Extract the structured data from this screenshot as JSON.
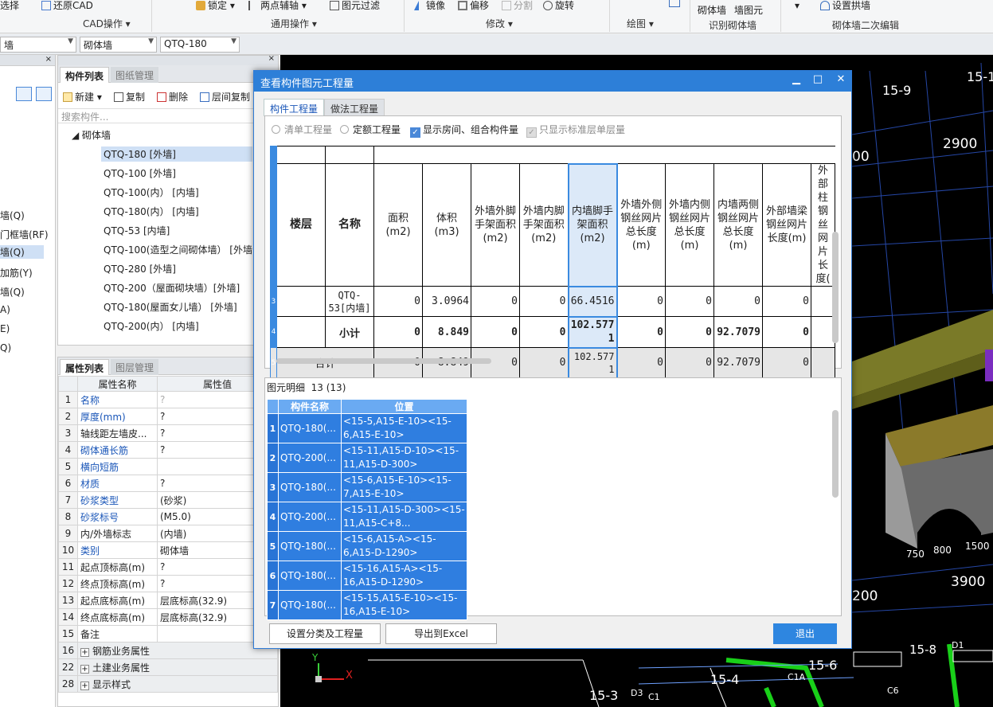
{
  "ribbon": {
    "items": {
      "select": "选择",
      "restore_cad": "还原CAD",
      "lock": "锁定",
      "two_point_axis": "两点辅轴",
      "element_filter": "图元过滤",
      "mirror": "镜像",
      "offset": "偏移",
      "split": "分割",
      "rotate": "旋转",
      "masonry_wall": "砌体墙",
      "wall_element": "墙图元",
      "set_arch": "设置拱墙"
    },
    "groups": {
      "cad_ops": "CAD操作",
      "common_ops": "通用操作",
      "modify": "修改",
      "draw": "绘图",
      "identify": "识别砌体墙",
      "edit2": "砌体墙二次编辑"
    }
  },
  "combos": {
    "c1": "墙",
    "c2": "砌体墙",
    "c3": "QTQ-180"
  },
  "left_panel": {
    "items": [
      "墙(Q)",
      "门框墙(RF)",
      "墙(Q)",
      "加筋(Y)",
      "墙(Q)",
      "A)",
      "E)",
      "Q)"
    ]
  },
  "component_panel": {
    "tab_active": "构件列表",
    "tab_inactive": "图纸管理",
    "toolbar": {
      "new": "新建",
      "copy": "复制",
      "delete": "删除",
      "floor_copy": "层间复制"
    },
    "search_placeholder": "搜索构件...",
    "root": "砌体墙",
    "items": [
      "QTQ-180 [外墙]",
      "QTQ-100 [外墙]",
      "QTQ-100(内） [内墙]",
      "QTQ-180(内） [内墙]",
      "QTQ-53 [内墙]",
      "QTQ-100(造型之间砌体墙） [外墙]",
      "QTQ-280 [外墙]",
      "QTQ-200（屋面砌块墙）[外墙]",
      "QTQ-180(屋面女儿墙） [外墙]",
      "QTQ-200(内） [内墙]"
    ]
  },
  "property_panel": {
    "tab_active": "属性列表",
    "tab_inactive": "图层管理",
    "col_name": "属性名称",
    "col_value": "属性值",
    "rows": [
      {
        "n": "1",
        "k": "名称",
        "v": "?"
      },
      {
        "n": "2",
        "k": "厚度(mm)",
        "v": "?"
      },
      {
        "n": "3",
        "k": "轴线距左墙皮...",
        "v": "?"
      },
      {
        "n": "4",
        "k": "砌体通长筋",
        "v": "?"
      },
      {
        "n": "5",
        "k": "横向短筋",
        "v": ""
      },
      {
        "n": "6",
        "k": "材质",
        "v": "?"
      },
      {
        "n": "7",
        "k": "砂浆类型",
        "v": "(砂浆)"
      },
      {
        "n": "8",
        "k": "砂浆标号",
        "v": "(M5.0)"
      },
      {
        "n": "9",
        "k": "内/外墙标志",
        "v": "(内墙)"
      },
      {
        "n": "10",
        "k": "类别",
        "v": "砌体墙"
      },
      {
        "n": "11",
        "k": "起点顶标高(m)",
        "v": "?"
      },
      {
        "n": "12",
        "k": "终点顶标高(m)",
        "v": "?"
      },
      {
        "n": "13",
        "k": "起点底标高(m)",
        "v": "层底标高(32.9)"
      },
      {
        "n": "14",
        "k": "终点底标高(m)",
        "v": "层底标高(32.9)"
      },
      {
        "n": "15",
        "k": "备注",
        "v": ""
      },
      {
        "n": "16",
        "k": "钢筋业务属性",
        "v": ""
      },
      {
        "n": "22",
        "k": "土建业务属性",
        "v": ""
      },
      {
        "n": "28",
        "k": "显示样式",
        "v": ""
      }
    ]
  },
  "dialog": {
    "title": "查看构件图元工程量",
    "tabs": [
      "构件工程量",
      "做法工程量"
    ],
    "options": {
      "list_qty": "清单工程量",
      "quota_qty": "定额工程量",
      "show_rooms": "显示房间、组合构件量",
      "std_floor": "只显示标准层单层量"
    },
    "headers": [
      "楼层",
      "名称",
      "面积(m2)",
      "体积(m3)",
      "外墙外脚手架面积(m2)",
      "外墙内脚手架面积(m2)",
      "内墙脚手架面积(m2)",
      "外墙外侧钢丝网片总长度(m)",
      "外墙内侧钢丝网片总长度(m)",
      "内墙两侧钢丝网片总长度(m)",
      "外部墙梁钢丝网片长度(m)",
      "外部柱钢丝网片长度("
    ],
    "rows": [
      {
        "rn": "3",
        "floor": "",
        "name": "QTQ-53[内墙]",
        "cells": [
          "0",
          "3.0964",
          "0",
          "0",
          "66.4516",
          "0",
          "0",
          "0",
          "0",
          ""
        ]
      },
      {
        "rn": "4",
        "floor": "",
        "name": "小计",
        "cells": [
          "0",
          "8.849",
          "0",
          "0",
          "102.5771",
          "0",
          "0",
          "92.7079",
          "0",
          ""
        ]
      },
      {
        "rn": "5",
        "floor": "合计",
        "name": "",
        "cells": [
          "0",
          "8.849",
          "0",
          "0",
          "102.5771",
          "0",
          "0",
          "92.7079",
          "0",
          ""
        ]
      }
    ],
    "detail_caption": "图元明细",
    "detail_count": "13 (13)",
    "detail_headers": [
      "构件名称",
      "位置"
    ],
    "detail_rows": [
      {
        "rn": "1",
        "name": "QTQ-180(...",
        "pos": "<15-5,A15-E-10><15-6,A15-E-10>"
      },
      {
        "rn": "2",
        "name": "QTQ-200(...",
        "pos": "<15-11,A15-D-10><15-11,A15-D-300>"
      },
      {
        "rn": "3",
        "name": "QTQ-180(...",
        "pos": "<15-6,A15-E-10><15-7,A15-E-10>"
      },
      {
        "rn": "4",
        "name": "QTQ-200(...",
        "pos": "<15-11,A15-D-300><15-11,A15-C+8..."
      },
      {
        "rn": "5",
        "name": "QTQ-180(...",
        "pos": "<15-6,A15-A><15-6,A15-D-1290>"
      },
      {
        "rn": "6",
        "name": "QTQ-180(...",
        "pos": "<15-16,A15-A><15-16,A15-D-1290>"
      },
      {
        "rn": "7",
        "name": "QTQ-180(...",
        "pos": "<15-15,A15-E-10><15-16,A15-E-10>"
      }
    ],
    "buttons": {
      "set_class": "设置分类及工程量",
      "export": "导出到Excel",
      "exit": "退出"
    }
  },
  "cad": {
    "labels": [
      "15-9",
      "15-1",
      "2900",
      "00",
      "750",
      "800",
      "1500",
      "3900",
      "200",
      "15-8",
      "D1",
      "15-6",
      "15-4",
      "15-3",
      "D3",
      "C1",
      "C1A",
      "C6",
      "Y",
      "X"
    ]
  },
  "colors": {
    "accent": "#2d7fd8",
    "selected": "#cfe0f5",
    "cad_bg": "#000000"
  }
}
